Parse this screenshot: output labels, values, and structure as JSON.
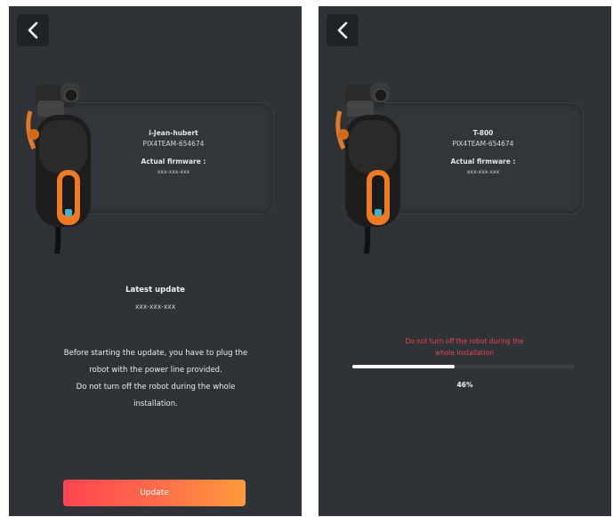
{
  "left_screen": {
    "device": {
      "name": "i-Jean-hubert",
      "team": "PIX4TEAM-654674",
      "firmware_label": "Actual firmware :",
      "firmware_value": "xxx-xxx-xxx"
    },
    "latest": {
      "title": "Latest update",
      "value": "xxx-xxx-xxx"
    },
    "notice_lines": [
      "Before starting the update, you have to plug the",
      "robot with the power line provided.",
      "Do not turn off the robot during the whole",
      "installation."
    ],
    "update_label": "Update"
  },
  "right_screen": {
    "device": {
      "name": "T-800",
      "team": "PIX4TEAM-654674",
      "firmware_label": "Actual firmware :",
      "firmware_value": "xxx-xxx-xxx"
    },
    "warning_lines": [
      "Do not turn off the robot during the",
      "whole installation"
    ],
    "progress": {
      "value": 0.46,
      "label": "46%"
    }
  },
  "icons": {
    "back": "chevron-left-icon",
    "robot": "robot-image"
  },
  "colors": {
    "background": "#2f3237",
    "warning": "#e84850",
    "button_gradient_start": "#ff4452",
    "button_gradient_end": "#ff9a3d"
  }
}
